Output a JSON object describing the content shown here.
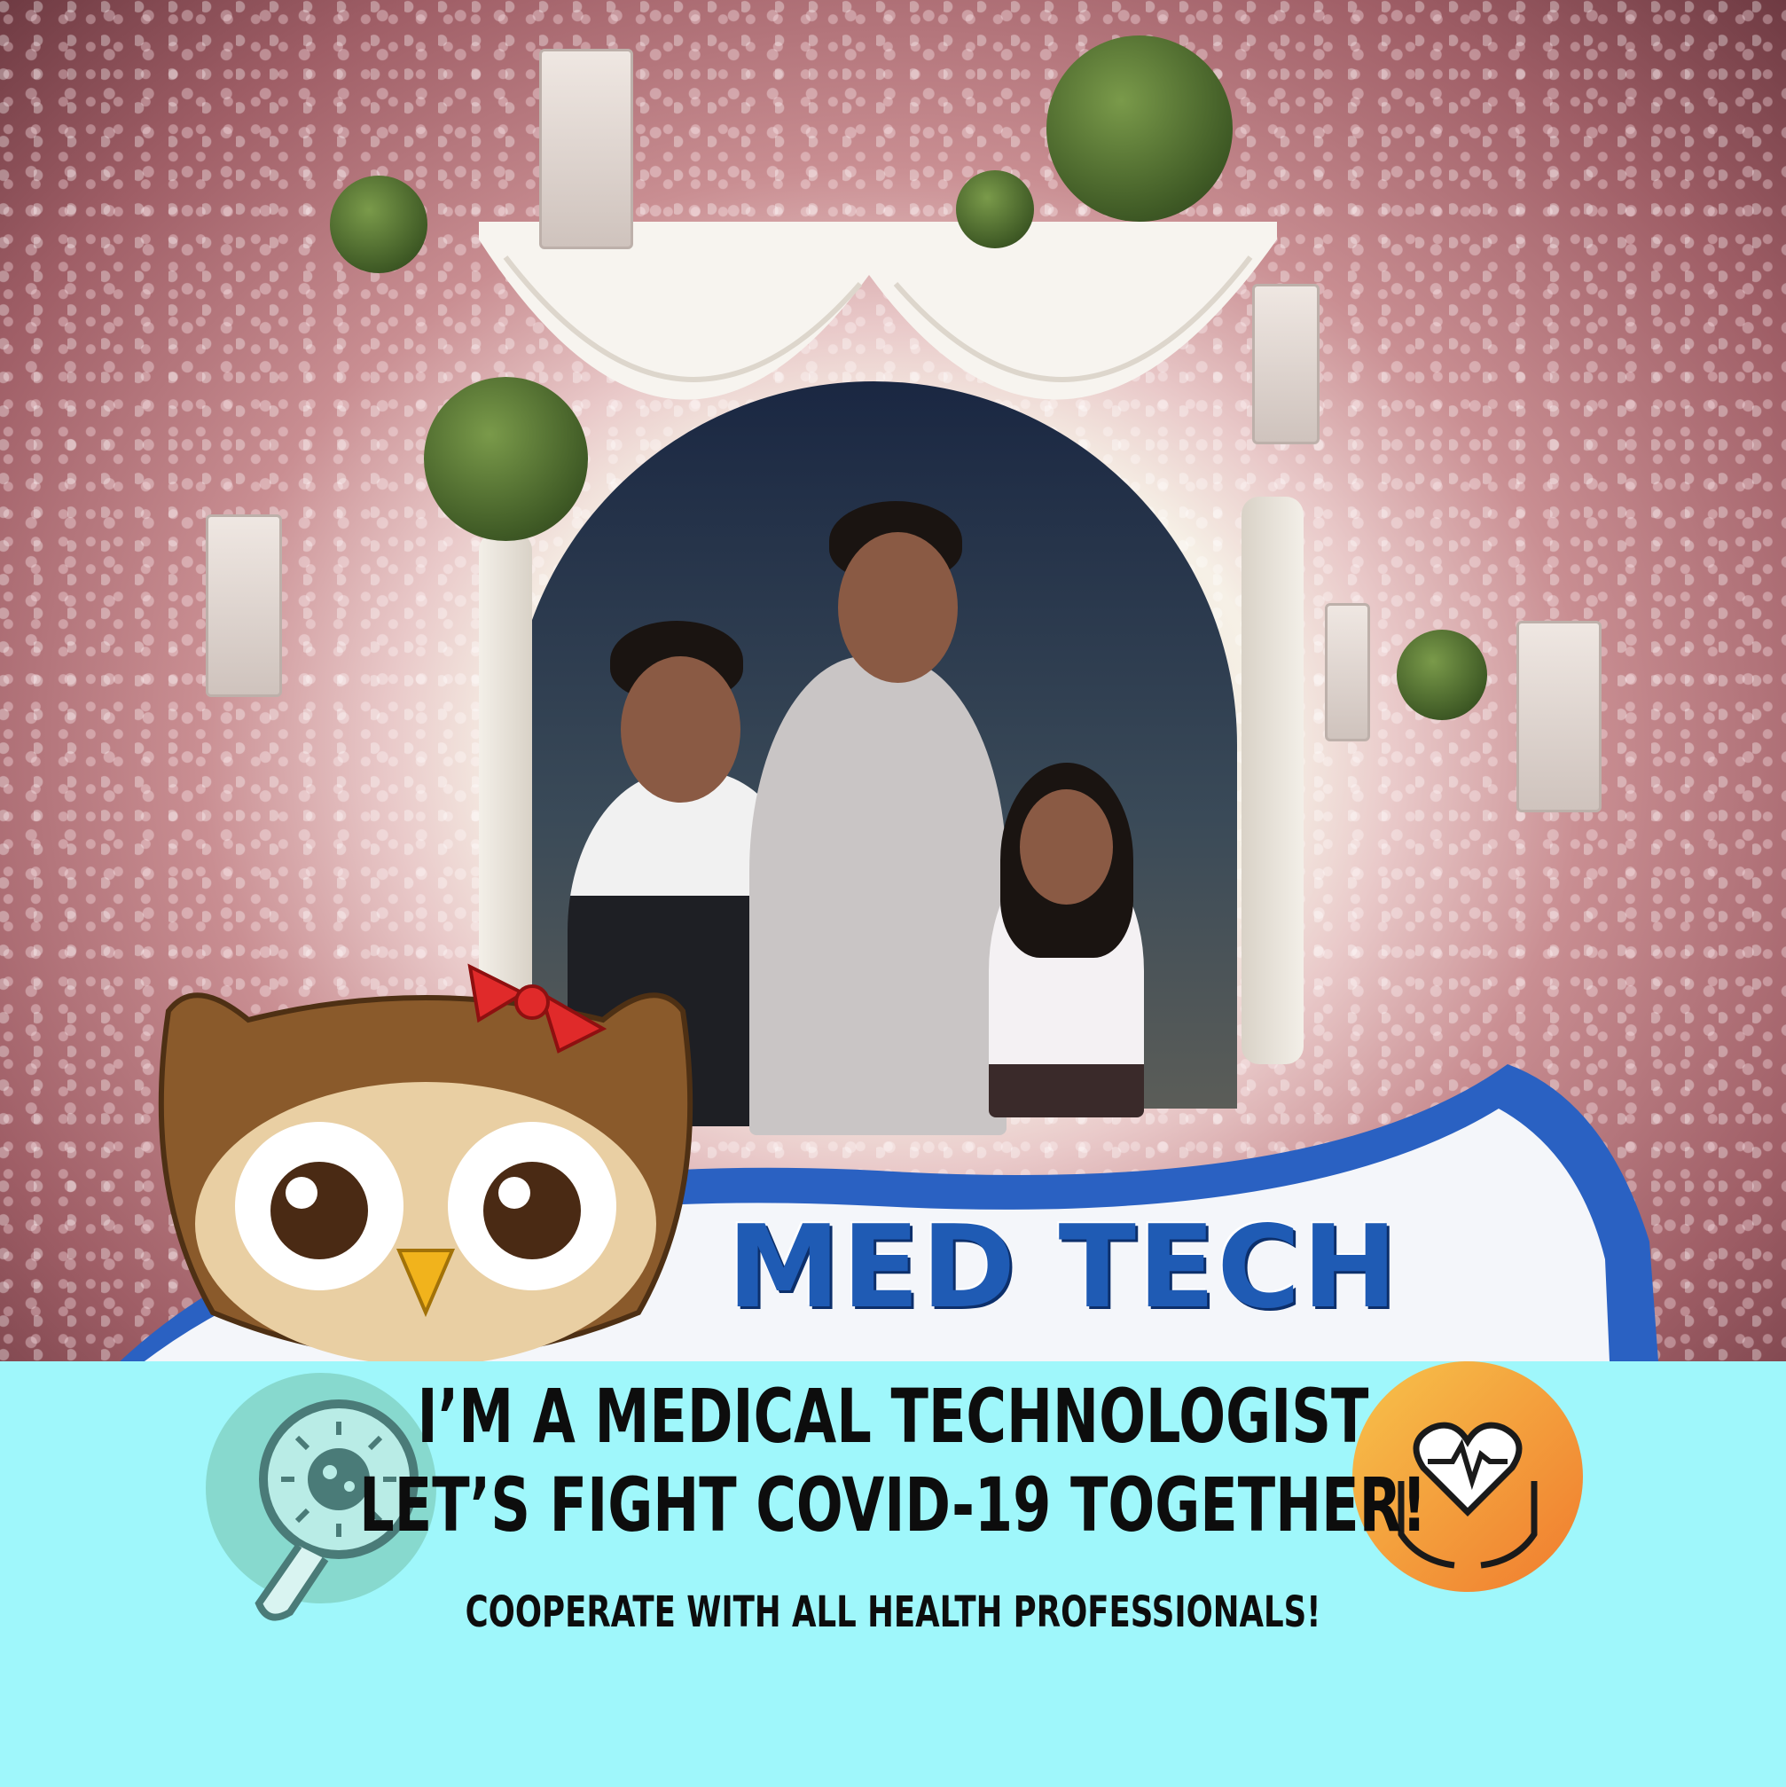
{
  "logo": {
    "title": "MED TECH"
  },
  "banner": {
    "line1": "I’M A MEDICAL TECHNOLOGIST",
    "line2": "LET’S FIGHT COVID-19 TOGETHER!",
    "line3": "COOPERATE WITH ALL HEALTH PROFESSIONALS!"
  },
  "icons": {
    "left": "virus-magnifier-icon",
    "right": "heart-in-hands-icon"
  },
  "colors": {
    "band": "#9ff7fb",
    "brand_blue": "#1f5bb4",
    "owl_brown": "#8a5a2b",
    "bow_red": "#e02a2a",
    "right_icon_orange": "#f29a3a",
    "left_icon_teal": "#7fcfbf"
  }
}
